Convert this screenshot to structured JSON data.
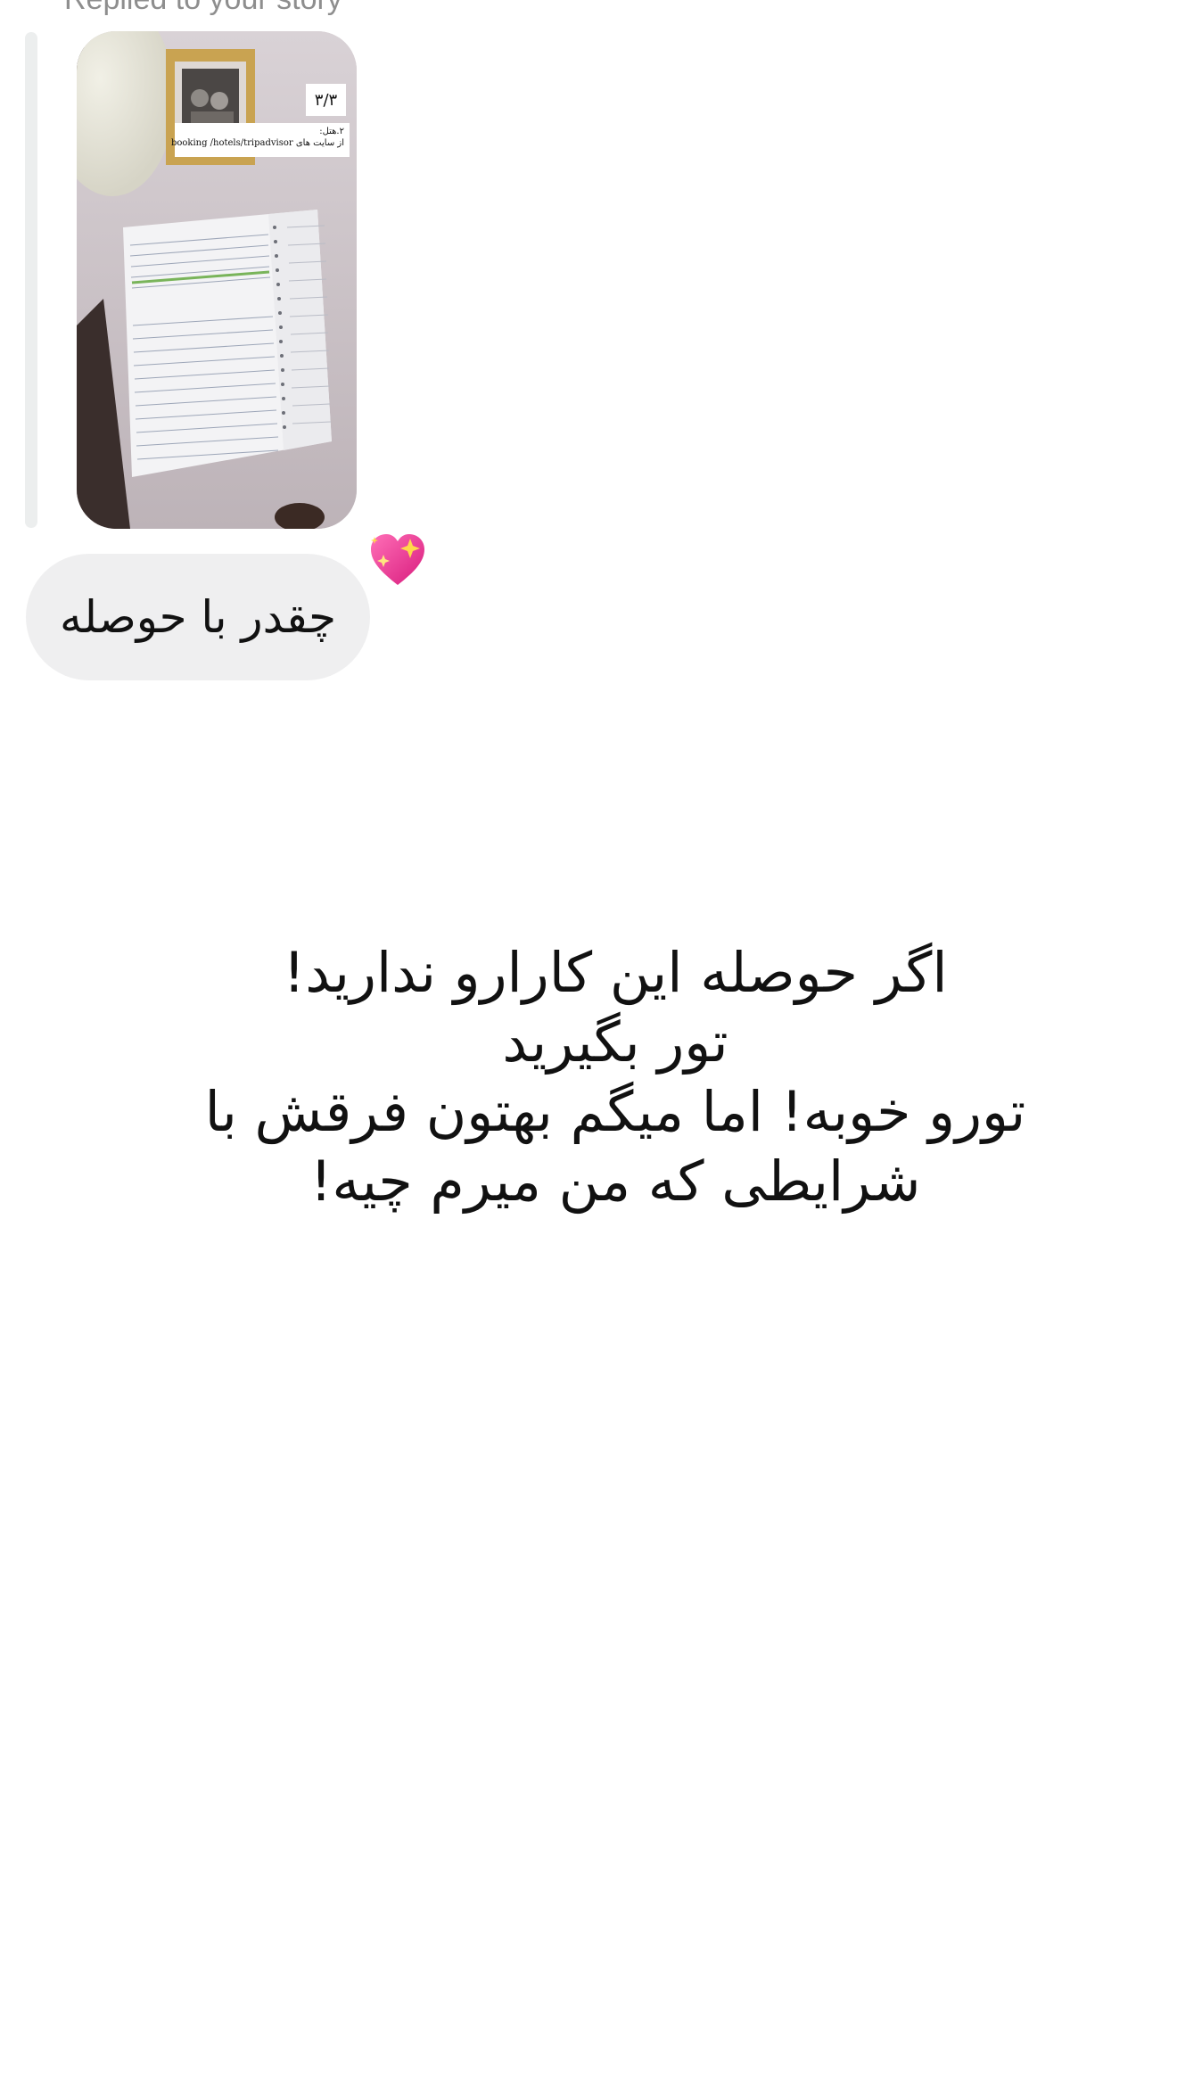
{
  "reply_context": {
    "label": "Replied to your story"
  },
  "story_preview": {
    "page_indicator": "۳/۳",
    "caption_line1": "۲.هتل:",
    "caption_line2": "از سایت های booking /hotels/tripadvisor"
  },
  "reaction": {
    "emoji": "sparkling-heart-icon"
  },
  "reply_message": {
    "text": "چقدر با حوصله"
  },
  "main_message": {
    "lines": [
      "اگر حوصله این کارارو ندارید!",
      "تور بگیرید",
      "تورو خوبه! اما میگم بهتون فرقش با",
      "شرایطی که من میرم چیه!"
    ]
  },
  "colors": {
    "bubble_bg": "#efeff0",
    "rail": "#eceeee",
    "label": "#8e8e8e",
    "text": "#111111",
    "heart": "#e0338f"
  }
}
